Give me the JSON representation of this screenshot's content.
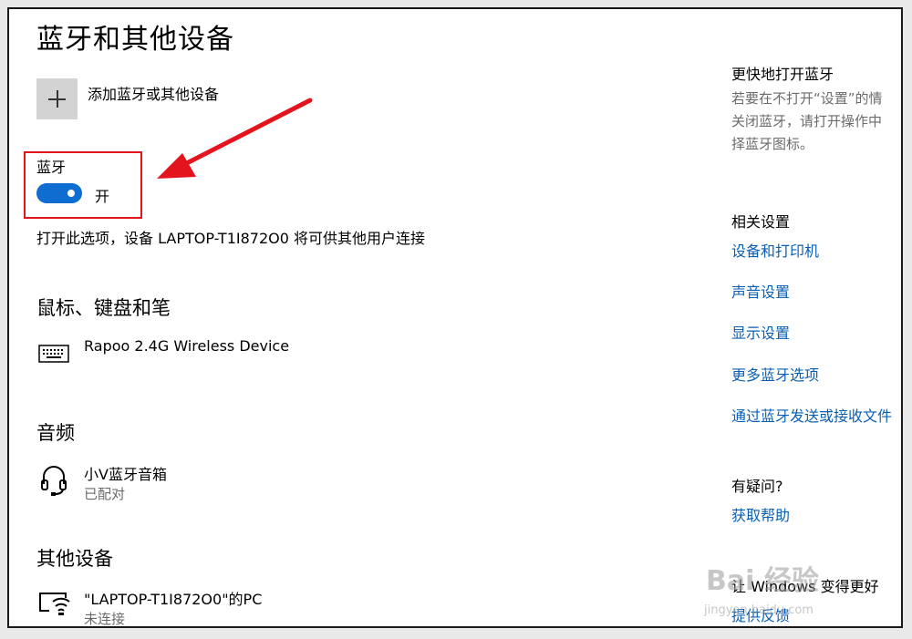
{
  "page": {
    "title": "蓝牙和其他设备"
  },
  "add_device": {
    "label": "添加蓝牙或其他设备",
    "icon": "plus-icon"
  },
  "bluetooth": {
    "label": "蓝牙",
    "toggle_state": "开",
    "toggle_on": true,
    "accent_color": "#0f6cd0",
    "description": "打开此选项，设备 LAPTOP-T1I872O0 将可供其他用户连接"
  },
  "annotation": {
    "color": "#e3141e"
  },
  "sections": {
    "mouse": {
      "title": "鼠标、键盘和笔",
      "devices": [
        {
          "name": "Rapoo 2.4G Wireless Device",
          "icon": "keyboard-icon"
        }
      ]
    },
    "audio": {
      "title": "音频",
      "devices": [
        {
          "name": "小V蓝牙音箱",
          "status": "已配对",
          "icon": "headset-icon"
        }
      ]
    },
    "other": {
      "title": "其他设备",
      "devices": [
        {
          "name": "\"LAPTOP-T1I872O0\"的PC",
          "status": "未连接",
          "icon": "wireless-display-icon"
        }
      ]
    }
  },
  "sidebar": {
    "quick_open": {
      "title": "更快地打开蓝牙",
      "text_lines": [
        "若要在不打开“设置”的情",
        "关闭蓝牙，请打开操作中",
        "择蓝牙图标。"
      ]
    },
    "related": {
      "title": "相关设置",
      "links": [
        "设备和打印机",
        "声音设置",
        "显示设置",
        "更多蓝牙选项",
        "通过蓝牙发送或接收文件"
      ]
    },
    "help": {
      "title": "有疑问?",
      "link": "获取帮助"
    },
    "feedback": {
      "title": "让 Windows 变得更好",
      "link": "提供反馈"
    }
  },
  "watermark": {
    "text": "Bai 经验",
    "url": "jingyan.baidu.com"
  }
}
